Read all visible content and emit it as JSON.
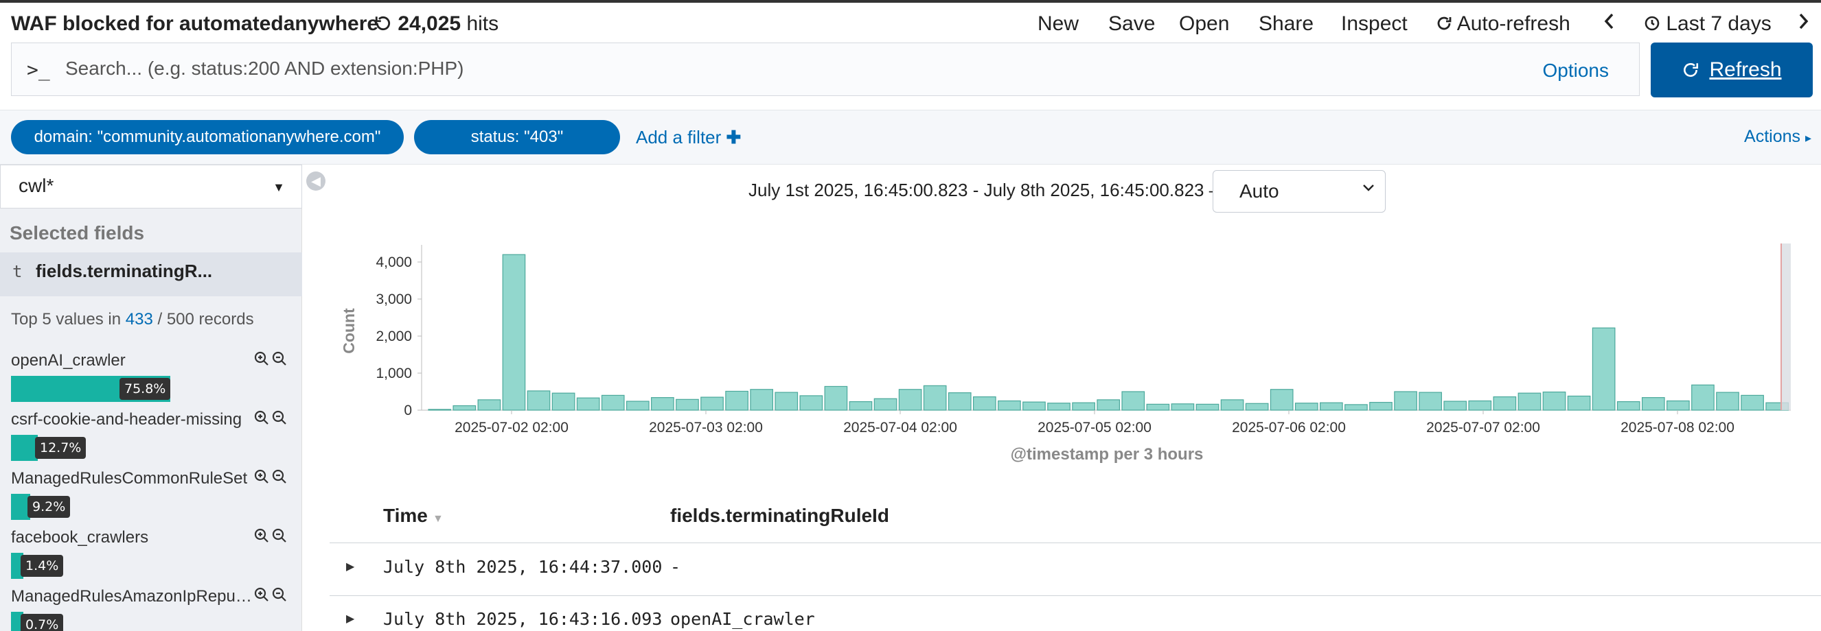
{
  "header": {
    "title": "WAF blocked for automatedanywhere",
    "hits_count": "24,025",
    "hits_label": "hits",
    "nav": [
      "New",
      "Save",
      "Open",
      "Share",
      "Inspect",
      "Auto-refresh"
    ],
    "time_range": "Last 7 days"
  },
  "search": {
    "prompt": ">_",
    "placeholder": "Search... (e.g. status:200 AND extension:PHP)",
    "value": "",
    "options_label": "Options",
    "refresh_label": "Refresh"
  },
  "filters": {
    "pills": [
      "domain: \"community.automationanywhere.com\"",
      "status: \"403\""
    ],
    "add_filter_label": "Add a filter",
    "actions_label": "Actions"
  },
  "sidebar": {
    "index_pattern": "cwl*",
    "selected_fields_label": "Selected fields",
    "field_type": "t",
    "field_name": "fields.terminatingR...",
    "top_values_prefix": "Top 5 values in",
    "top_values_count": "433",
    "top_values_suffix": "/ 500 records",
    "values": [
      {
        "name": "openAI_crawler",
        "pct": 75.8,
        "label": "75.8%"
      },
      {
        "name": "csrf-cookie-and-header-missing",
        "pct": 12.7,
        "label": "12.7%"
      },
      {
        "name": "ManagedRulesCommonRuleSet",
        "pct": 9.2,
        "label": "9.2%"
      },
      {
        "name": "facebook_crawlers",
        "pct": 1.4,
        "label": "1.4%"
      },
      {
        "name": "ManagedRulesAmazonIpReputationList",
        "pct": 0.7,
        "label": "0.7%"
      }
    ]
  },
  "histogram": {
    "date_range": "July 1st 2025, 16:45:00.823 - July 8th 2025, 16:45:00.823 —",
    "interval": "Auto"
  },
  "chart_data": {
    "type": "bar",
    "ylabel": "Count",
    "xlabel": "@timestamp per 3 hours",
    "ylim": [
      0,
      4500
    ],
    "yticks": [
      "0",
      "1,000",
      "2,000",
      "3,000",
      "4,000"
    ],
    "xticks": [
      "2025-07-02 02:00",
      "2025-07-03 02:00",
      "2025-07-04 02:00",
      "2025-07-05 02:00",
      "2025-07-06 02:00",
      "2025-07-07 02:00",
      "2025-07-08 02:00"
    ],
    "values": [
      20,
      120,
      280,
      4200,
      520,
      460,
      330,
      400,
      240,
      340,
      290,
      350,
      510,
      560,
      480,
      390,
      640,
      230,
      310,
      560,
      660,
      470,
      360,
      250,
      220,
      190,
      200,
      280,
      500,
      160,
      170,
      160,
      280,
      180,
      560,
      190,
      200,
      150,
      210,
      500,
      480,
      240,
      250,
      360,
      460,
      490,
      380,
      2220,
      230,
      340,
      250,
      680,
      480,
      400,
      200
    ],
    "grid": false,
    "colors": {
      "bar_fill": "#92d7cd",
      "bar_stroke": "#4ba89b",
      "now_marker": "#e3a3a3"
    }
  },
  "table": {
    "columns": [
      "Time",
      "fields.terminatingRuleId"
    ],
    "rows": [
      {
        "time": "July 8th 2025, 16:44:37.000",
        "rule": "-"
      },
      {
        "time": "July 8th 2025, 16:43:16.093",
        "rule": "openAI_crawler"
      }
    ]
  }
}
